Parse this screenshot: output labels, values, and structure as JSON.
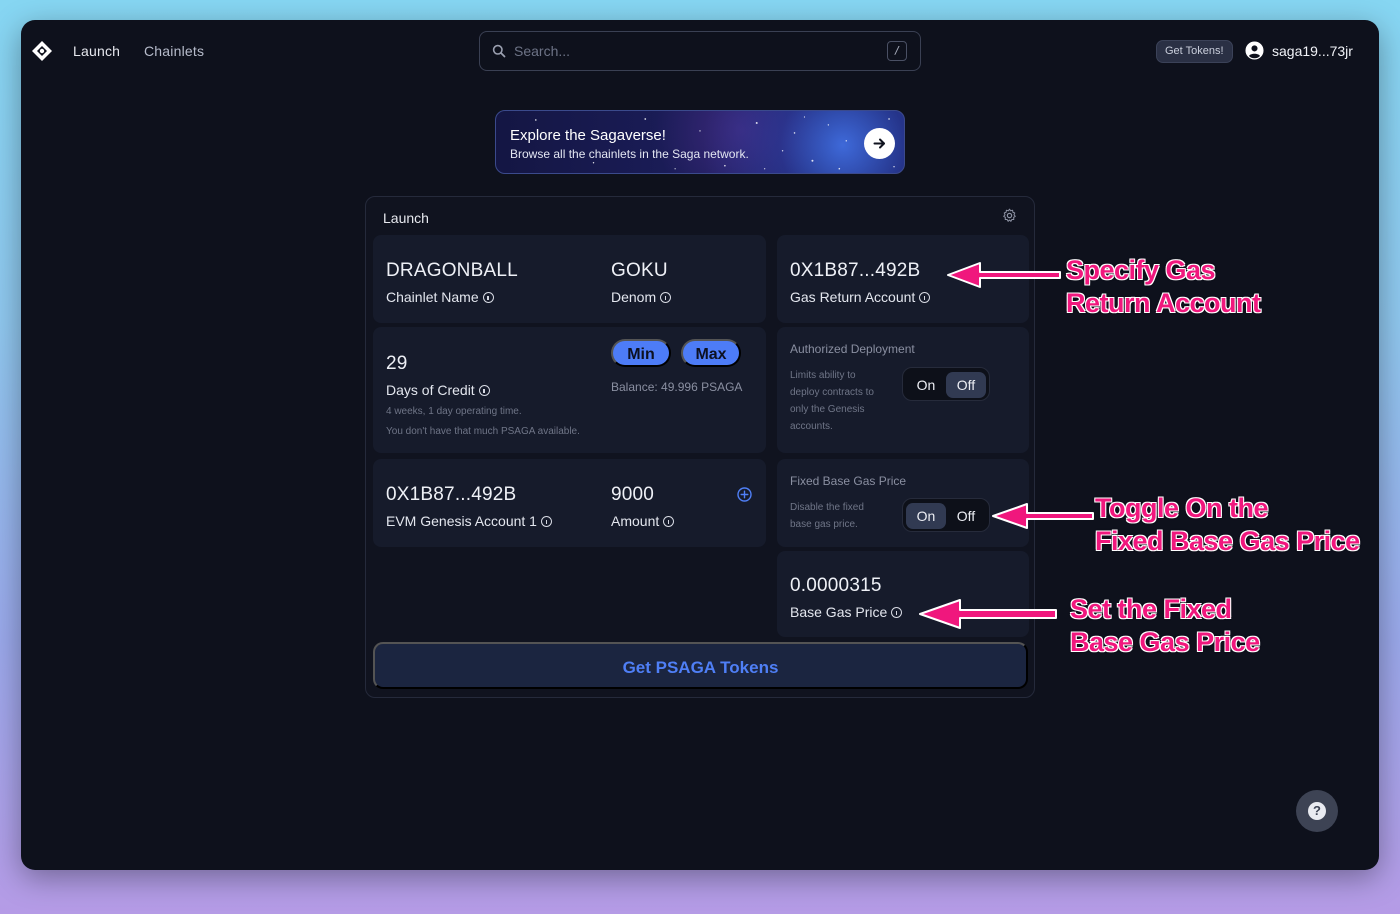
{
  "nav": {
    "launch": "Launch",
    "chainlets": "Chainlets",
    "search_placeholder": "Search...",
    "search_shortcut": "/",
    "get_tokens": "Get Tokens!",
    "user": "saga19...73jr"
  },
  "banner": {
    "title": "Explore the Sagaverse!",
    "subtitle": "Browse all the chainlets in the Saga network."
  },
  "panel": {
    "title": "Launch",
    "chainlet_name": {
      "value": "DRAGONBALL",
      "label": "Chainlet Name"
    },
    "denom": {
      "value": "GOKU",
      "label": "Denom"
    },
    "gas_return": {
      "value": "0X1B87...492B",
      "label": "Gas Return Account"
    },
    "credit": {
      "value": "29",
      "label": "Days of Credit",
      "note1": "4 weeks, 1 day operating time.",
      "note2": "You don't have that much PSAGA available.",
      "min": "Min",
      "max": "Max",
      "balance": "Balance: 49.996 PSAGA"
    },
    "authorized": {
      "title": "Authorized Deployment",
      "desc": [
        "Limits ability to",
        "deploy contracts to",
        "only the Genesis",
        "accounts."
      ],
      "on": "On",
      "off": "Off",
      "selected": "Off"
    },
    "genesis": {
      "account": "0X1B87...492B",
      "account_label": "EVM Genesis Account 1",
      "amount": "9000",
      "amount_label": "Amount"
    },
    "fixed_gas": {
      "title": "Fixed Base Gas Price",
      "desc": [
        "Disable the fixed",
        "base gas price."
      ],
      "on": "On",
      "off": "Off",
      "selected": "On"
    },
    "base_gas": {
      "value": "0.0000315",
      "label": "Base Gas Price"
    },
    "cta": "Get PSAGA Tokens"
  },
  "annotations": {
    "gas_return": [
      "Specify Gas",
      "Return Account"
    ],
    "toggle": [
      "Toggle On the",
      "Fixed Base Gas Price"
    ],
    "base_gas": [
      "Set the Fixed",
      "Base Gas Price"
    ],
    "color": "#f0177d"
  },
  "help": "?"
}
